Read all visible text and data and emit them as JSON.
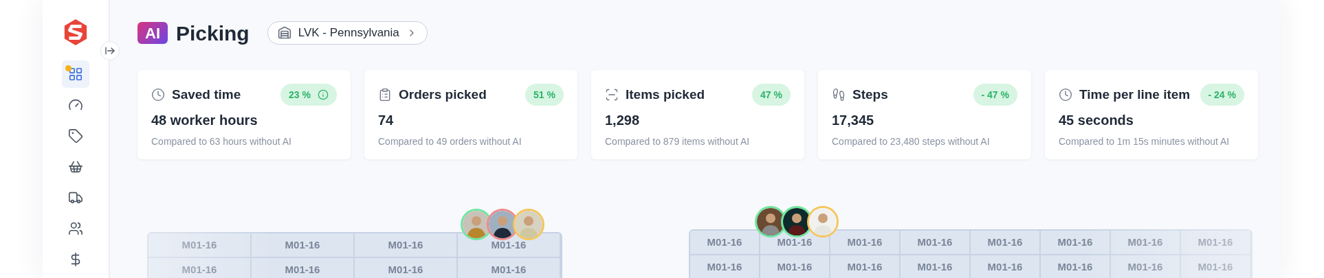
{
  "sidebar": {
    "items": [
      {
        "selected": true,
        "notification": true
      },
      {
        "selected": false,
        "notification": false
      },
      {
        "selected": false,
        "notification": false
      },
      {
        "selected": false,
        "notification": false
      },
      {
        "selected": false,
        "notification": false
      },
      {
        "selected": false,
        "notification": false
      },
      {
        "selected": false,
        "notification": false
      }
    ]
  },
  "header": {
    "badge": "AI",
    "title": "Picking",
    "location": "LVK - Pennsylvania"
  },
  "cards": [
    {
      "title": "Saved time",
      "change": "23 %",
      "info": true,
      "value": "48 worker hours",
      "comparison": "Compared to 63 hours without AI"
    },
    {
      "title": "Orders picked",
      "change": "51 %",
      "info": false,
      "value": "74",
      "comparison": "Compared to 49 orders without AI"
    },
    {
      "title": "Items picked",
      "change": "47 %",
      "info": false,
      "value": "1,298",
      "comparison": "Compared to 879 items without AI"
    },
    {
      "title": "Steps",
      "change": "- 47 %",
      "info": false,
      "value": "17,345",
      "comparison": "Compared to 23,480 steps without AI"
    },
    {
      "title": "Time per line item",
      "change": "- 24 %",
      "info": false,
      "value": "45 seconds",
      "comparison": "Compared to 1m 15s minutes without AI"
    }
  ],
  "shelves": [
    {
      "avatars": [
        {
          "color": "#6ee7a0"
        },
        {
          "color": "#f08a8a"
        },
        {
          "color": "#f5c65a"
        }
      ],
      "rows": [
        [
          "M01-16",
          "M01-16",
          "M01-16",
          "M01-16"
        ],
        [
          "M01-16",
          "M01-16",
          "M01-16",
          "M01-16"
        ]
      ]
    },
    {
      "avatars": [
        {
          "color": "#6ee7a0"
        },
        {
          "color": "#6ee7a0"
        },
        {
          "color": "#f5c65a"
        }
      ],
      "rows": [
        [
          "M01-16",
          "M01-16",
          "M01-16",
          "M01-16",
          "M01-16",
          "M01-16",
          "M01-16",
          "M01-16"
        ],
        [
          "M01-16",
          "M01-16",
          "M01-16",
          "M01-16",
          "M01-16",
          "M01-16",
          "M01-16",
          "M01-16"
        ]
      ]
    }
  ]
}
